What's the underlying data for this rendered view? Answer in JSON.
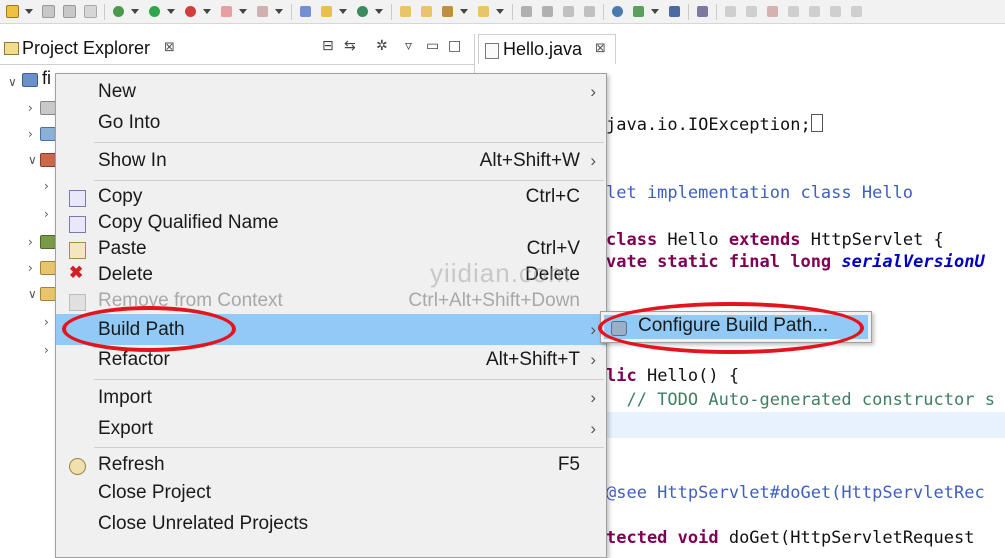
{
  "explorer": {
    "title": "Project Explorer",
    "close_glyph": "⊠",
    "root_label": "fi"
  },
  "editor": {
    "tab_label": "Hello.java",
    "close_glyph": "⊠"
  },
  "context_menu": {
    "items": [
      {
        "label": "New",
        "shortcut": "",
        "submenu": true
      },
      {
        "label": "Go Into",
        "shortcut": "",
        "submenu": false
      },
      {
        "label": "Show In",
        "shortcut": "Alt+Shift+W",
        "submenu": true
      },
      {
        "label": "Copy",
        "shortcut": "Ctrl+C",
        "submenu": false,
        "icon": "copy-icon"
      },
      {
        "label": "Copy Qualified Name",
        "shortcut": "",
        "submenu": false,
        "icon": "copy-qualified-icon"
      },
      {
        "label": "Paste",
        "shortcut": "Ctrl+V",
        "submenu": false,
        "icon": "paste-icon"
      },
      {
        "label": "Delete",
        "shortcut": "Delete",
        "submenu": false,
        "icon": "delete-icon"
      },
      {
        "label": "Remove from Context",
        "shortcut": "Ctrl+Alt+Shift+Down",
        "submenu": false,
        "disabled": true,
        "icon": "remove-context-icon"
      },
      {
        "label": "Build Path",
        "shortcut": "",
        "submenu": true,
        "active": true
      },
      {
        "label": "Refactor",
        "shortcut": "Alt+Shift+T",
        "submenu": true
      },
      {
        "label": "Import",
        "shortcut": "",
        "submenu": true
      },
      {
        "label": "Export",
        "shortcut": "",
        "submenu": true
      },
      {
        "label": "Refresh",
        "shortcut": "F5",
        "submenu": false,
        "icon": "refresh-icon"
      },
      {
        "label": "Close Project",
        "shortcut": "",
        "submenu": false
      },
      {
        "label": "Close Unrelated Projects",
        "shortcut": "",
        "submenu": false
      }
    ],
    "submenu_arrow": "›"
  },
  "build_path_submenu": {
    "items": [
      {
        "label": "Configure Build Path...",
        "icon": "configure-build-path-icon",
        "active": true
      }
    ]
  },
  "code": {
    "l1": "java.io.IOException;",
    "l2": "let implementation class Hello",
    "l3_kw1": "class",
    "l3_a": " Hello ",
    "l3_kw2": "extends",
    "l3_b": " HttpServlet {",
    "l4_kw": "vate static final long",
    "l4_it": "serialVersionU",
    "l5_kw": "lic",
    "l5_b": " Hello() {",
    "l6": "  // TODO Auto-generated constructor s",
    "l7": "@see HttpServlet#doGet(HttpServletRec",
    "l8_kw": "tected void",
    "l8_b": " doGet(HttpServletRequest"
  },
  "watermark": "yiidian.com",
  "colors": {
    "menu_highlight": "#91c9f7",
    "annotation_red": "#e4141f",
    "keyword": "#7f0055",
    "javadoc": "#3f5fbf",
    "comment": "#3f7f5f"
  }
}
